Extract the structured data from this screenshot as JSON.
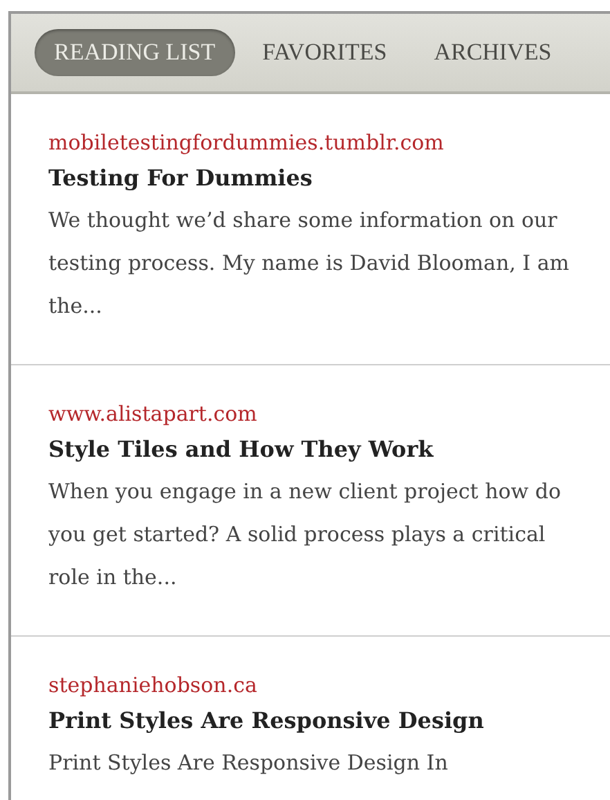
{
  "tabs": [
    {
      "label": "READING LIST",
      "selected": true
    },
    {
      "label": "FAVORITES",
      "selected": false
    },
    {
      "label": "ARCHIVES",
      "selected": false
    }
  ],
  "articles": [
    {
      "source": "mobiletestingfordummies.tumblr.com",
      "title": "Testing For Dummies",
      "excerpt": "We thought we’d share some information on our testing process. My name is David Blooman, I am the..."
    },
    {
      "source": "www.alistapart.com",
      "title": "Style Tiles and How They Work",
      "excerpt": "When you engage in a new client project how do you get started? A solid process plays a critical role in the..."
    },
    {
      "source": "stephaniehobson.ca",
      "title": "Print Styles Are Responsive Design",
      "excerpt": "Print Styles Are Responsive Design In"
    }
  ]
}
